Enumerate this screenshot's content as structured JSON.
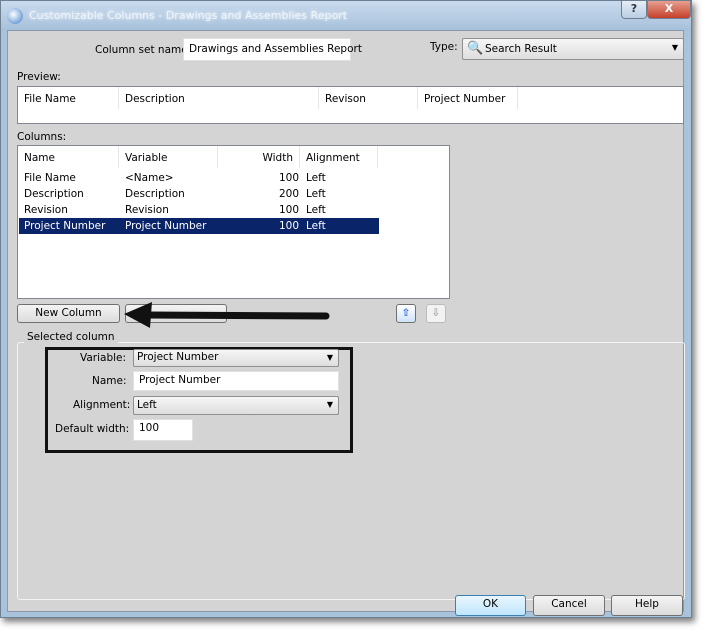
{
  "window": {
    "title": "Customizable Columns - Drawings and Assemblies Report",
    "help": "?",
    "close": "X"
  },
  "header": {
    "column_set_label": "Column set name:",
    "column_set_value": "Drawings and Assemblies Report",
    "type_label": "Type:",
    "type_value": "Search Result",
    "type_icon": "magnifier-icon"
  },
  "preview": {
    "label": "Preview:",
    "headers": [
      "File Name",
      "Description",
      "Revison",
      "Project Number"
    ]
  },
  "columns": {
    "label": "Columns:",
    "headers": [
      "Name",
      "Variable",
      "Width",
      "Alignment"
    ],
    "rows": [
      {
        "name": "File Name",
        "variable": "<Name>",
        "width": "100",
        "alignment": "Left"
      },
      {
        "name": "Description",
        "variable": "Description",
        "width": "200",
        "alignment": "Left"
      },
      {
        "name": "Revision",
        "variable": "Revision",
        "width": "100",
        "alignment": "Left"
      },
      {
        "name": "Project Number",
        "variable": "Project Number",
        "width": "100",
        "alignment": "Left",
        "selected": true
      }
    ]
  },
  "buttons": {
    "new_column": "New Column",
    "ok": "OK",
    "cancel": "Cancel",
    "help": "Help"
  },
  "selected_column": {
    "label": "Selected column",
    "variable_label": "Variable:",
    "variable_value": "Project Number",
    "name_label": "Name:",
    "name_value": "Project Number",
    "alignment_label": "Alignment:",
    "alignment_value": "Left",
    "width_label": "Default width:",
    "width_value": "100"
  },
  "colors": {
    "selection": "#0a246a",
    "dialog": "#d4d4d4"
  }
}
